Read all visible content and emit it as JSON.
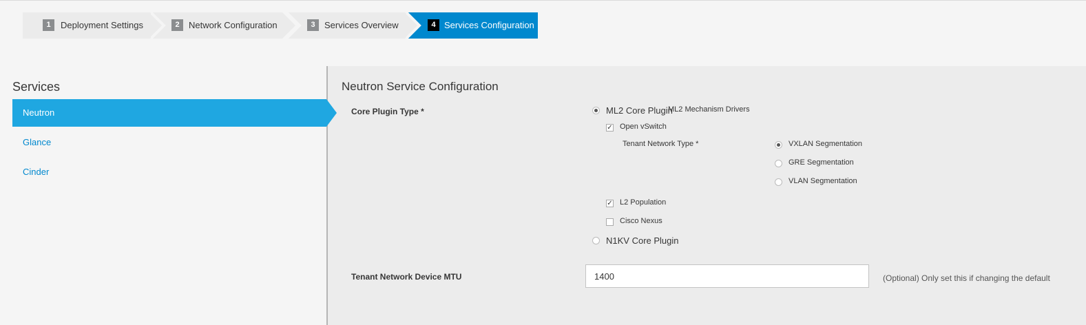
{
  "wizard": {
    "steps": [
      {
        "number": "1",
        "label": "Deployment Settings"
      },
      {
        "number": "2",
        "label": "Network Configuration"
      },
      {
        "number": "3",
        "label": "Services Overview"
      },
      {
        "number": "4",
        "label": "Services Configuration"
      }
    ],
    "active_step": "4"
  },
  "sidebar": {
    "title": "Services",
    "items": [
      {
        "label": "Neutron",
        "active": true
      },
      {
        "label": "Glance",
        "active": false
      },
      {
        "label": "Cinder",
        "active": false
      }
    ]
  },
  "main": {
    "title": "Neutron Service Configuration",
    "core_plugin": {
      "label": "Core Plugin Type *",
      "options": [
        {
          "label": "ML2 Core Plugin",
          "selected": true
        },
        {
          "label": "N1KV Core Plugin",
          "selected": false
        }
      ],
      "ml2_drivers_label": "ML2 Mechanism Drivers",
      "drivers": [
        {
          "label": "Open vSwitch",
          "checked": true
        },
        {
          "label": "L2 Population",
          "checked": true
        },
        {
          "label": "Cisco Nexus",
          "checked": false
        }
      ],
      "tenant_network_type": {
        "label": "Tenant Network Type *",
        "options": [
          {
            "label": "VXLAN Segmentation",
            "selected": true
          },
          {
            "label": "GRE Segmentation",
            "selected": false
          },
          {
            "label": "VLAN Segmentation",
            "selected": false
          }
        ]
      }
    },
    "mtu": {
      "label": "Tenant Network Device MTU",
      "value": "1400",
      "help": "(Optional) Only set this if changing the default"
    }
  },
  "colors": {
    "accent": "#0088ce",
    "active_nav": "#1fa7e1",
    "active_step": "#0088ce",
    "step_bg": "#ebebeb"
  },
  "icons": {
    "checkbox_checked": "check-icon"
  }
}
